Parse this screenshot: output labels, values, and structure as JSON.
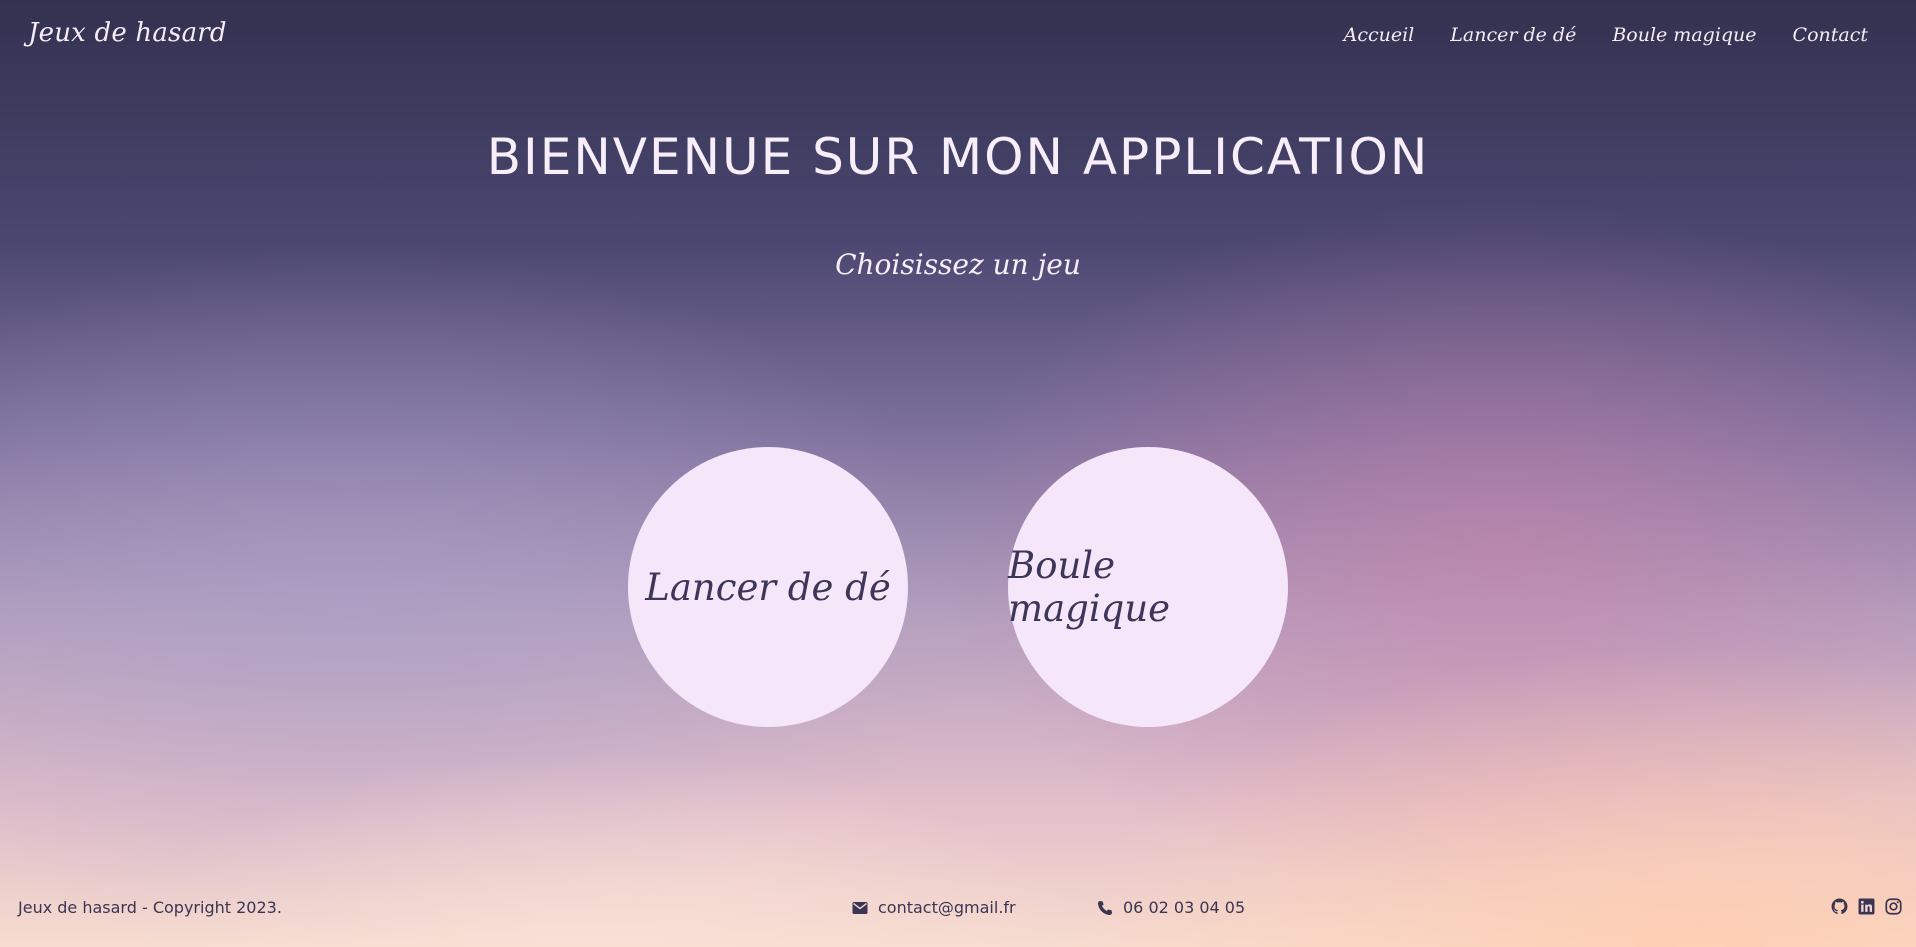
{
  "header": {
    "brand": "Jeux de hasard",
    "nav": [
      {
        "label": "Accueil"
      },
      {
        "label": "Lancer de dé"
      },
      {
        "label": "Boule magique"
      },
      {
        "label": "Contact"
      }
    ]
  },
  "main": {
    "title": "BIENVENUE SUR MON APPLICATION",
    "subtitle": "Choisissez un jeu",
    "games": [
      {
        "label": "Lancer de dé"
      },
      {
        "label": "Boule magique"
      }
    ]
  },
  "footer": {
    "copyright": "Jeux de hasard - Copyright 2023.",
    "email": "contact@gmail.fr",
    "phone": "06 02 03 04 05",
    "icons": {
      "email": "envelope-icon",
      "phone": "phone-icon",
      "socials": [
        "github-icon",
        "linkedin-icon",
        "instagram-icon"
      ]
    }
  },
  "colors": {
    "text_light": "#f6ecf6",
    "circle_bg": "#f6e6f9",
    "circle_text": "#3e3658",
    "footer_text": "#3b3552"
  }
}
